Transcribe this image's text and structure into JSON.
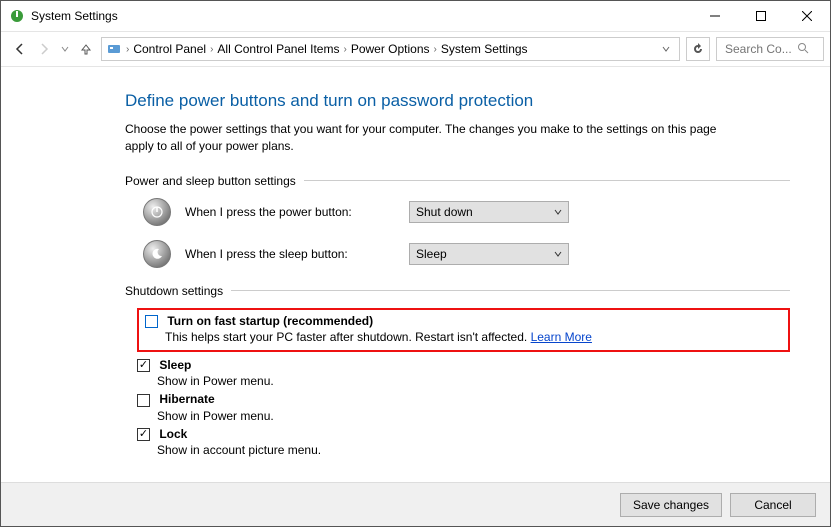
{
  "window": {
    "title": "System Settings"
  },
  "breadcrumb": {
    "items": [
      "Control Panel",
      "All Control Panel Items",
      "Power Options",
      "System Settings"
    ]
  },
  "search": {
    "placeholder": "Search Co..."
  },
  "page": {
    "heading": "Define power buttons and turn on password protection",
    "description": "Choose the power settings that you want for your computer. The changes you make to the settings on this page apply to all of your power plans."
  },
  "section_buttons": {
    "label": "Power and sleep button settings",
    "rows": [
      {
        "label": "When I press the power button:",
        "value": "Shut down"
      },
      {
        "label": "When I press the sleep button:",
        "value": "Sleep"
      }
    ]
  },
  "section_shutdown": {
    "label": "Shutdown settings",
    "items": [
      {
        "checked": false,
        "title": "Turn on fast startup (recommended)",
        "desc": "This helps start your PC faster after shutdown. Restart isn't affected.",
        "link": "Learn More",
        "highlight": true
      },
      {
        "checked": true,
        "title": "Sleep",
        "desc": "Show in Power menu."
      },
      {
        "checked": false,
        "title": "Hibernate",
        "desc": "Show in Power menu."
      },
      {
        "checked": true,
        "title": "Lock",
        "desc": "Show in account picture menu."
      }
    ]
  },
  "footer": {
    "save": "Save changes",
    "cancel": "Cancel"
  }
}
